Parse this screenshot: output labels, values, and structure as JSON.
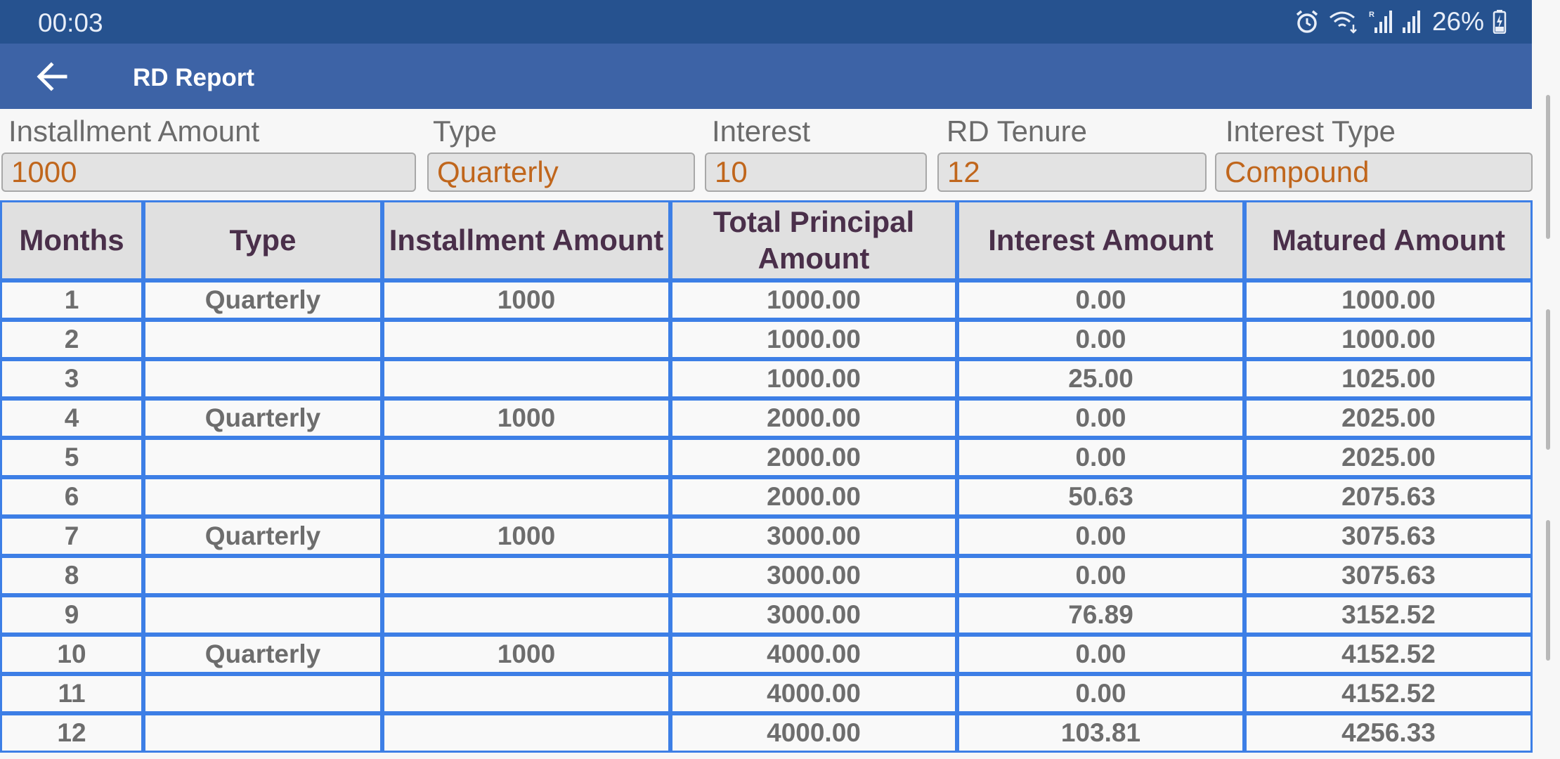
{
  "status_bar": {
    "time": "00:03",
    "battery_percent": "26%",
    "icons": [
      "alarm-icon",
      "wifi-calling-icon",
      "signal-roaming-icon",
      "signal-icon",
      "battery-charging-icon"
    ]
  },
  "app_bar": {
    "title": "RD Report",
    "back_icon": "arrow-left-icon"
  },
  "inputs": {
    "installment_amount": {
      "label": "Installment Amount",
      "value": "1000"
    },
    "type": {
      "label": "Type",
      "value": "Quarterly"
    },
    "interest": {
      "label": "Interest",
      "value": "10"
    },
    "tenure": {
      "label": "RD Tenure",
      "value": "12"
    },
    "interest_type": {
      "label": "Interest Type",
      "value": "Compound"
    }
  },
  "table": {
    "headers": [
      "Months",
      "Type",
      "Installment Amount",
      "Total Principal Amount",
      "Interest Amount",
      "Matured Amount"
    ],
    "rows": [
      [
        "1",
        "Quarterly",
        "1000",
        "1000.00",
        "0.00",
        "1000.00"
      ],
      [
        "2",
        "",
        "",
        "1000.00",
        "0.00",
        "1000.00"
      ],
      [
        "3",
        "",
        "",
        "1000.00",
        "25.00",
        "1025.00"
      ],
      [
        "4",
        "Quarterly",
        "1000",
        "2000.00",
        "0.00",
        "2025.00"
      ],
      [
        "5",
        "",
        "",
        "2000.00",
        "0.00",
        "2025.00"
      ],
      [
        "6",
        "",
        "",
        "2000.00",
        "50.63",
        "2075.63"
      ],
      [
        "7",
        "Quarterly",
        "1000",
        "3000.00",
        "0.00",
        "3075.63"
      ],
      [
        "8",
        "",
        "",
        "3000.00",
        "0.00",
        "3075.63"
      ],
      [
        "9",
        "",
        "",
        "3000.00",
        "76.89",
        "3152.52"
      ],
      [
        "10",
        "Quarterly",
        "1000",
        "4000.00",
        "0.00",
        "4152.52"
      ],
      [
        "11",
        "",
        "",
        "4000.00",
        "0.00",
        "4152.52"
      ],
      [
        "12",
        "",
        "",
        "4000.00",
        "103.81",
        "4256.33"
      ]
    ]
  },
  "colors": {
    "status_bar": "#26528f",
    "app_bar": "#3d63a6",
    "table_border": "#3d7fe6",
    "input_value": "#c0661c",
    "header_text": "#4a2f4a"
  }
}
